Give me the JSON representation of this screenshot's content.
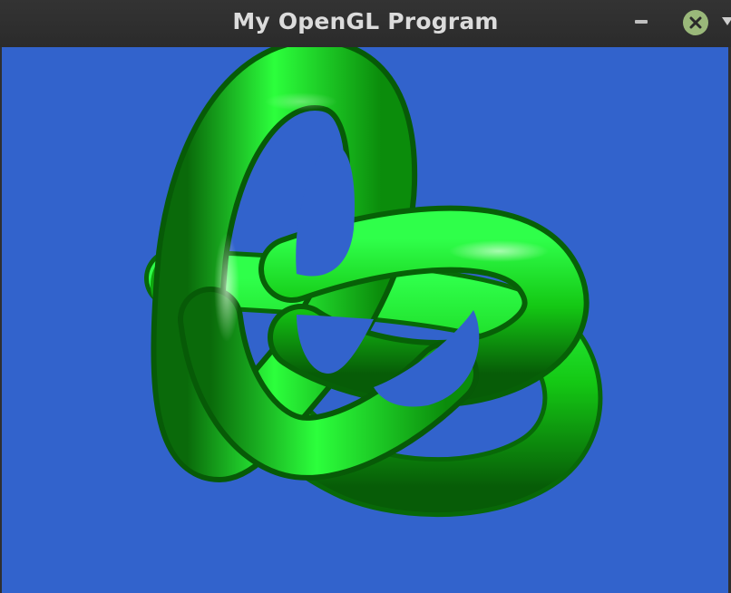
{
  "window": {
    "title": "My OpenGL Program"
  },
  "colors": {
    "background": "#3263cc",
    "knot": "#19e619",
    "titlebar": "#2f2f2f",
    "close": "#9ab87a"
  },
  "icons": {
    "minimize": "minimize-icon",
    "close": "close-icon",
    "menu": "chevron-down-icon"
  }
}
